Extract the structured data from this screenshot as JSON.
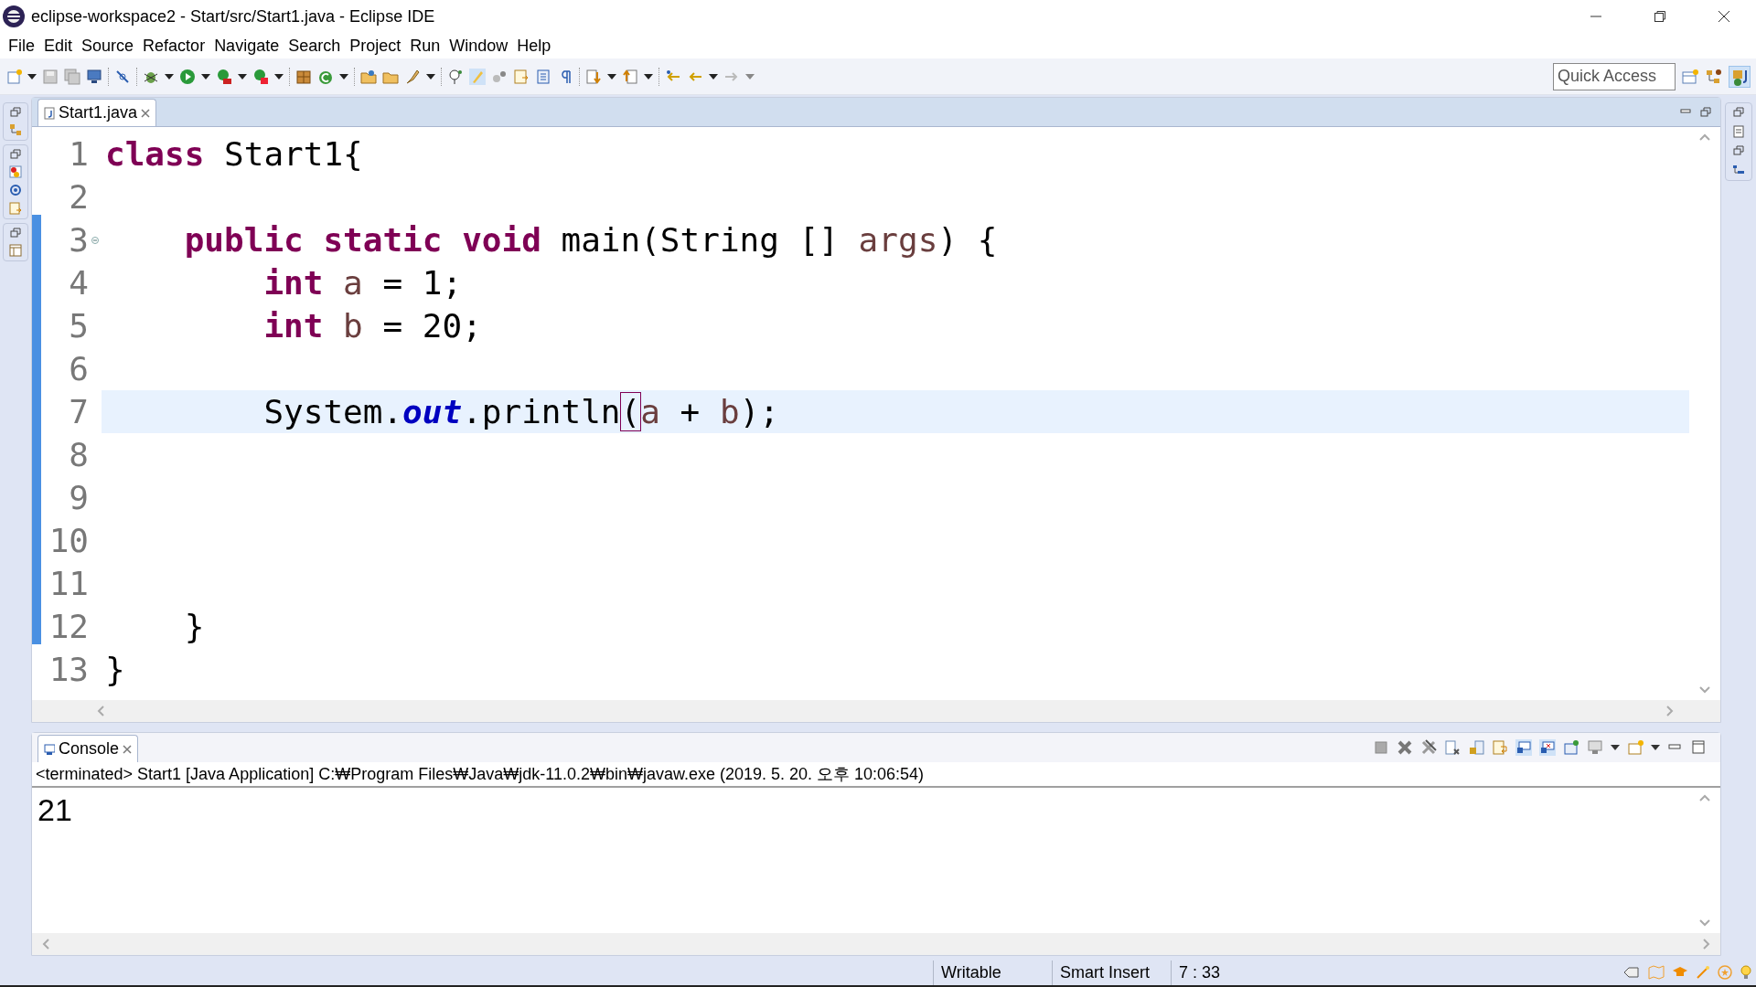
{
  "window": {
    "title": "eclipse-workspace2 - Start/src/Start1.java - Eclipse IDE"
  },
  "menu": [
    "File",
    "Edit",
    "Source",
    "Refactor",
    "Navigate",
    "Search",
    "Project",
    "Run",
    "Window",
    "Help"
  ],
  "quick_access": {
    "placeholder": "Quick Access"
  },
  "editor": {
    "tabs": [
      {
        "label": "Start1.java",
        "selected": true
      }
    ],
    "lines": [
      {
        "number": "1",
        "current": false,
        "tokens": [
          {
            "kind": "keyword",
            "text": "class"
          },
          {
            "kind": "plain",
            "text": " Start1{"
          }
        ]
      },
      {
        "number": "2",
        "current": false
      },
      {
        "number": "3",
        "current": false,
        "fold": true,
        "tokens": [
          {
            "kind": "keyword",
            "text": "    public static void"
          },
          {
            "kind": "plain",
            "text": " main(String [] "
          },
          {
            "kind": "variable",
            "text": "args"
          },
          {
            "kind": "plain",
            "text": ") {"
          }
        ]
      },
      {
        "number": "4",
        "current": false,
        "tokens": [
          {
            "kind": "keyword",
            "text": "        int"
          },
          {
            "kind": "variable",
            "text": " a"
          },
          {
            "kind": "plain",
            "text": " = 1;"
          }
        ]
      },
      {
        "number": "5",
        "current": false,
        "tokens": [
          {
            "kind": "keyword",
            "text": "        int"
          },
          {
            "kind": "variable",
            "text": " b"
          },
          {
            "kind": "plain",
            "text": " = 20;"
          }
        ]
      },
      {
        "number": "6",
        "current": false
      },
      {
        "number": "7",
        "current": true,
        "tokens": [
          {
            "kind": "plain",
            "text": "        System."
          },
          {
            "kind": "static",
            "text": "out"
          },
          {
            "kind": "plain",
            "text": ".println"
          },
          {
            "kind": "bracket",
            "text": "("
          },
          {
            "kind": "variable",
            "text": "a"
          },
          {
            "kind": "plain",
            "text": " + "
          },
          {
            "kind": "variable",
            "text": "b"
          },
          {
            "kind": "plain",
            "text": ");"
          }
        ]
      },
      {
        "number": "8",
        "current": false
      },
      {
        "number": "9",
        "current": false
      },
      {
        "number": "10",
        "current": false
      },
      {
        "number": "11",
        "current": false
      },
      {
        "number": "12",
        "current": false,
        "tokens": [
          {
            "kind": "plain",
            "text": "    }"
          }
        ]
      },
      {
        "number": "13",
        "current": false,
        "tokens": [
          {
            "kind": "plain",
            "text": "}"
          }
        ]
      }
    ]
  },
  "console": {
    "tab": {
      "label": "Console",
      "selected": true
    },
    "header": "<terminated> Start1 [Java Application] C:₩Program Files₩Java₩jdk-11.0.2₩bin₩javaw.exe (2019. 5. 20. 오후 10:06:54)",
    "output": "21"
  },
  "status_bar": {
    "mode": "Writable",
    "insert": "Smart Insert",
    "position": "7 : 33"
  }
}
